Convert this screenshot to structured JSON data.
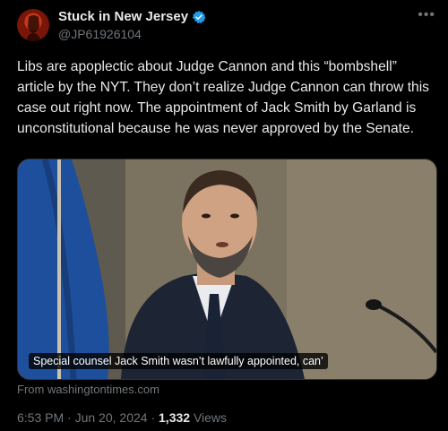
{
  "author": {
    "display_name": "Stuck in New Jersey",
    "handle": "@JP61926104",
    "verified": true,
    "verified_color": "#1d9bf0"
  },
  "icons": {
    "more": "more-horizontal-icon",
    "verified": "verified-badge-icon"
  },
  "tweet": {
    "text": "Libs are apoplectic about Judge Cannon and this “bombshell” article by the NYT. They don’t realize Judge Cannon can throw this case out right now. The appointment of Jack Smith by Garland is unconstitutional because he was never approved by the Senate."
  },
  "card": {
    "caption": "Special counsel Jack Smith wasn’t lawfully appointed, can’",
    "source": "From washingtontimes.com"
  },
  "meta": {
    "time": "6:53 PM",
    "separator": "·",
    "date": "Jun 20, 2024",
    "views_count": "1,332",
    "views_label": "Views"
  },
  "colors": {
    "background": "#000000",
    "text": "#e7e9ea",
    "muted": "#71767b"
  }
}
